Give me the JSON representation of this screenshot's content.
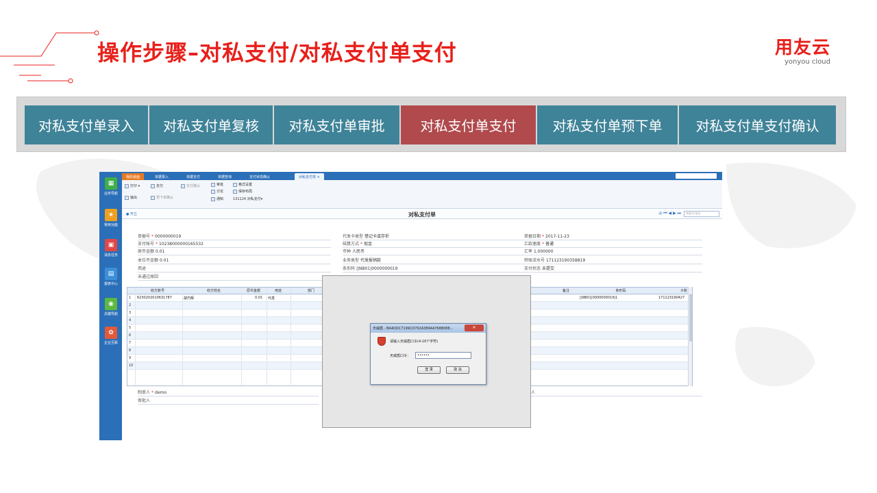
{
  "slide": {
    "title": "操作步骤–对私支付/对私支付单支付",
    "logo_main": "用友云",
    "logo_sub": "yonyou cloud"
  },
  "steps": [
    {
      "label": "对私支付单录入",
      "active": false
    },
    {
      "label": "对私支付单复核",
      "active": false
    },
    {
      "label": "对私支付单审批",
      "active": false
    },
    {
      "label": "对私支付单支付",
      "active": true
    },
    {
      "label": "对私支付单预下单",
      "active": false
    },
    {
      "label": "对私支付单支付确认",
      "active": false
    }
  ],
  "colors": {
    "accent": "#e8201b",
    "step": "#3f8398",
    "step_active": "#b04a4d",
    "nc_blue": "#2b6fb8"
  },
  "sidebar": [
    {
      "label": "业务导航",
      "icon": "grid-icon"
    },
    {
      "label": "常用功能",
      "icon": "star-icon"
    },
    {
      "label": "消息任务",
      "icon": "calendar-icon"
    },
    {
      "label": "报表中心",
      "icon": "report-icon"
    },
    {
      "label": "关键导航",
      "icon": "circle-icon"
    },
    {
      "label": "企业互联",
      "icon": "link-icon"
    }
  ],
  "tabs": [
    "我的桌面",
    "单据录入",
    "单据支付",
    "单据查询",
    "支付状态确认",
    "对私支付单 ×"
  ],
  "toolbar": {
    "print": "打印 ▾",
    "export": "输出",
    "pay": "支付",
    "presign": "预下单确认",
    "confirm": "支付确认",
    "approve": "审批",
    "discuss": "讨论",
    "notify": "通知",
    "format": "格式设置",
    "save_layout": "保存布局",
    "config": "131124 对私支付▾"
  },
  "doc": {
    "open": "● 开立",
    "title": "对私支付单",
    "nav": "◎ ⏮ ◀ ▶ ⏭",
    "search_placeholder": "单据号/条码"
  },
  "form": {
    "bill_no": {
      "label": "单据号",
      "value": "0000000019"
    },
    "pay_account": {
      "label": "支付账号",
      "value": "10238000000165532"
    },
    "orig_amount": {
      "label": "原币金额",
      "value": "0.01"
    },
    "local_amount": {
      "label": "本位币金额",
      "value": "0.01"
    },
    "usage": {
      "label": "用途",
      "value": ""
    },
    "reject_reason": {
      "label": "未通过原因",
      "value": ""
    },
    "card_type": {
      "label": "代发卡类型",
      "value": "借记卡或存折"
    },
    "settle_method": {
      "label": "结算方式",
      "value": "现金"
    },
    "currency": {
      "label": "币种",
      "value": "人民币"
    },
    "biz_type": {
      "label": "业务类型",
      "value": "代发报销款"
    },
    "barcode": {
      "label": "条形码",
      "value": "||NB01|0000000019"
    },
    "bill_date": {
      "label": "单据日期",
      "value": "2017-11-23"
    },
    "rate_speed": {
      "label": "汇款速度",
      "value": "普通"
    },
    "exchange_rate": {
      "label": "汇率",
      "value": "1.000000"
    },
    "serial_no": {
      "label": "转账流水号",
      "value": "171123190358819"
    },
    "pay_status": {
      "label": "支付状态",
      "value": "未提交"
    },
    "maker": {
      "label": "制单人",
      "value": "demo"
    },
    "approver": {
      "label": "审批人",
      "value": ""
    },
    "other": {
      "label": "人",
      "value": ""
    }
  },
  "grid": {
    "headers": [
      "收方账号",
      "收方姓名",
      "原币金额",
      "用途",
      "部门",
      "备注",
      "条形码",
      "子账"
    ],
    "rows": [
      {
        "no": "1",
        "account": "6230202010631787",
        "name": "胡巧辉",
        "amount": "0.01",
        "usage": "代发",
        "barcode": "||NB01|0000000019|1",
        "sub": "171123190427"
      },
      {
        "no": "2"
      },
      {
        "no": "3"
      },
      {
        "no": "4"
      },
      {
        "no": "5"
      },
      {
        "no": "6"
      },
      {
        "no": "7"
      },
      {
        "no": "8"
      },
      {
        "no": "9"
      },
      {
        "no": "10"
      }
    ]
  },
  "dialog": {
    "title": "天威盾 - BA4DDC7199CD702A3894A7688088...",
    "close": "✕",
    "prompt": "请输入天威盾口令(4-16个字符)",
    "pin_label": "天威盾口令：",
    "pin_value": "••••••",
    "ok": "登 录",
    "cancel": "取 消"
  }
}
